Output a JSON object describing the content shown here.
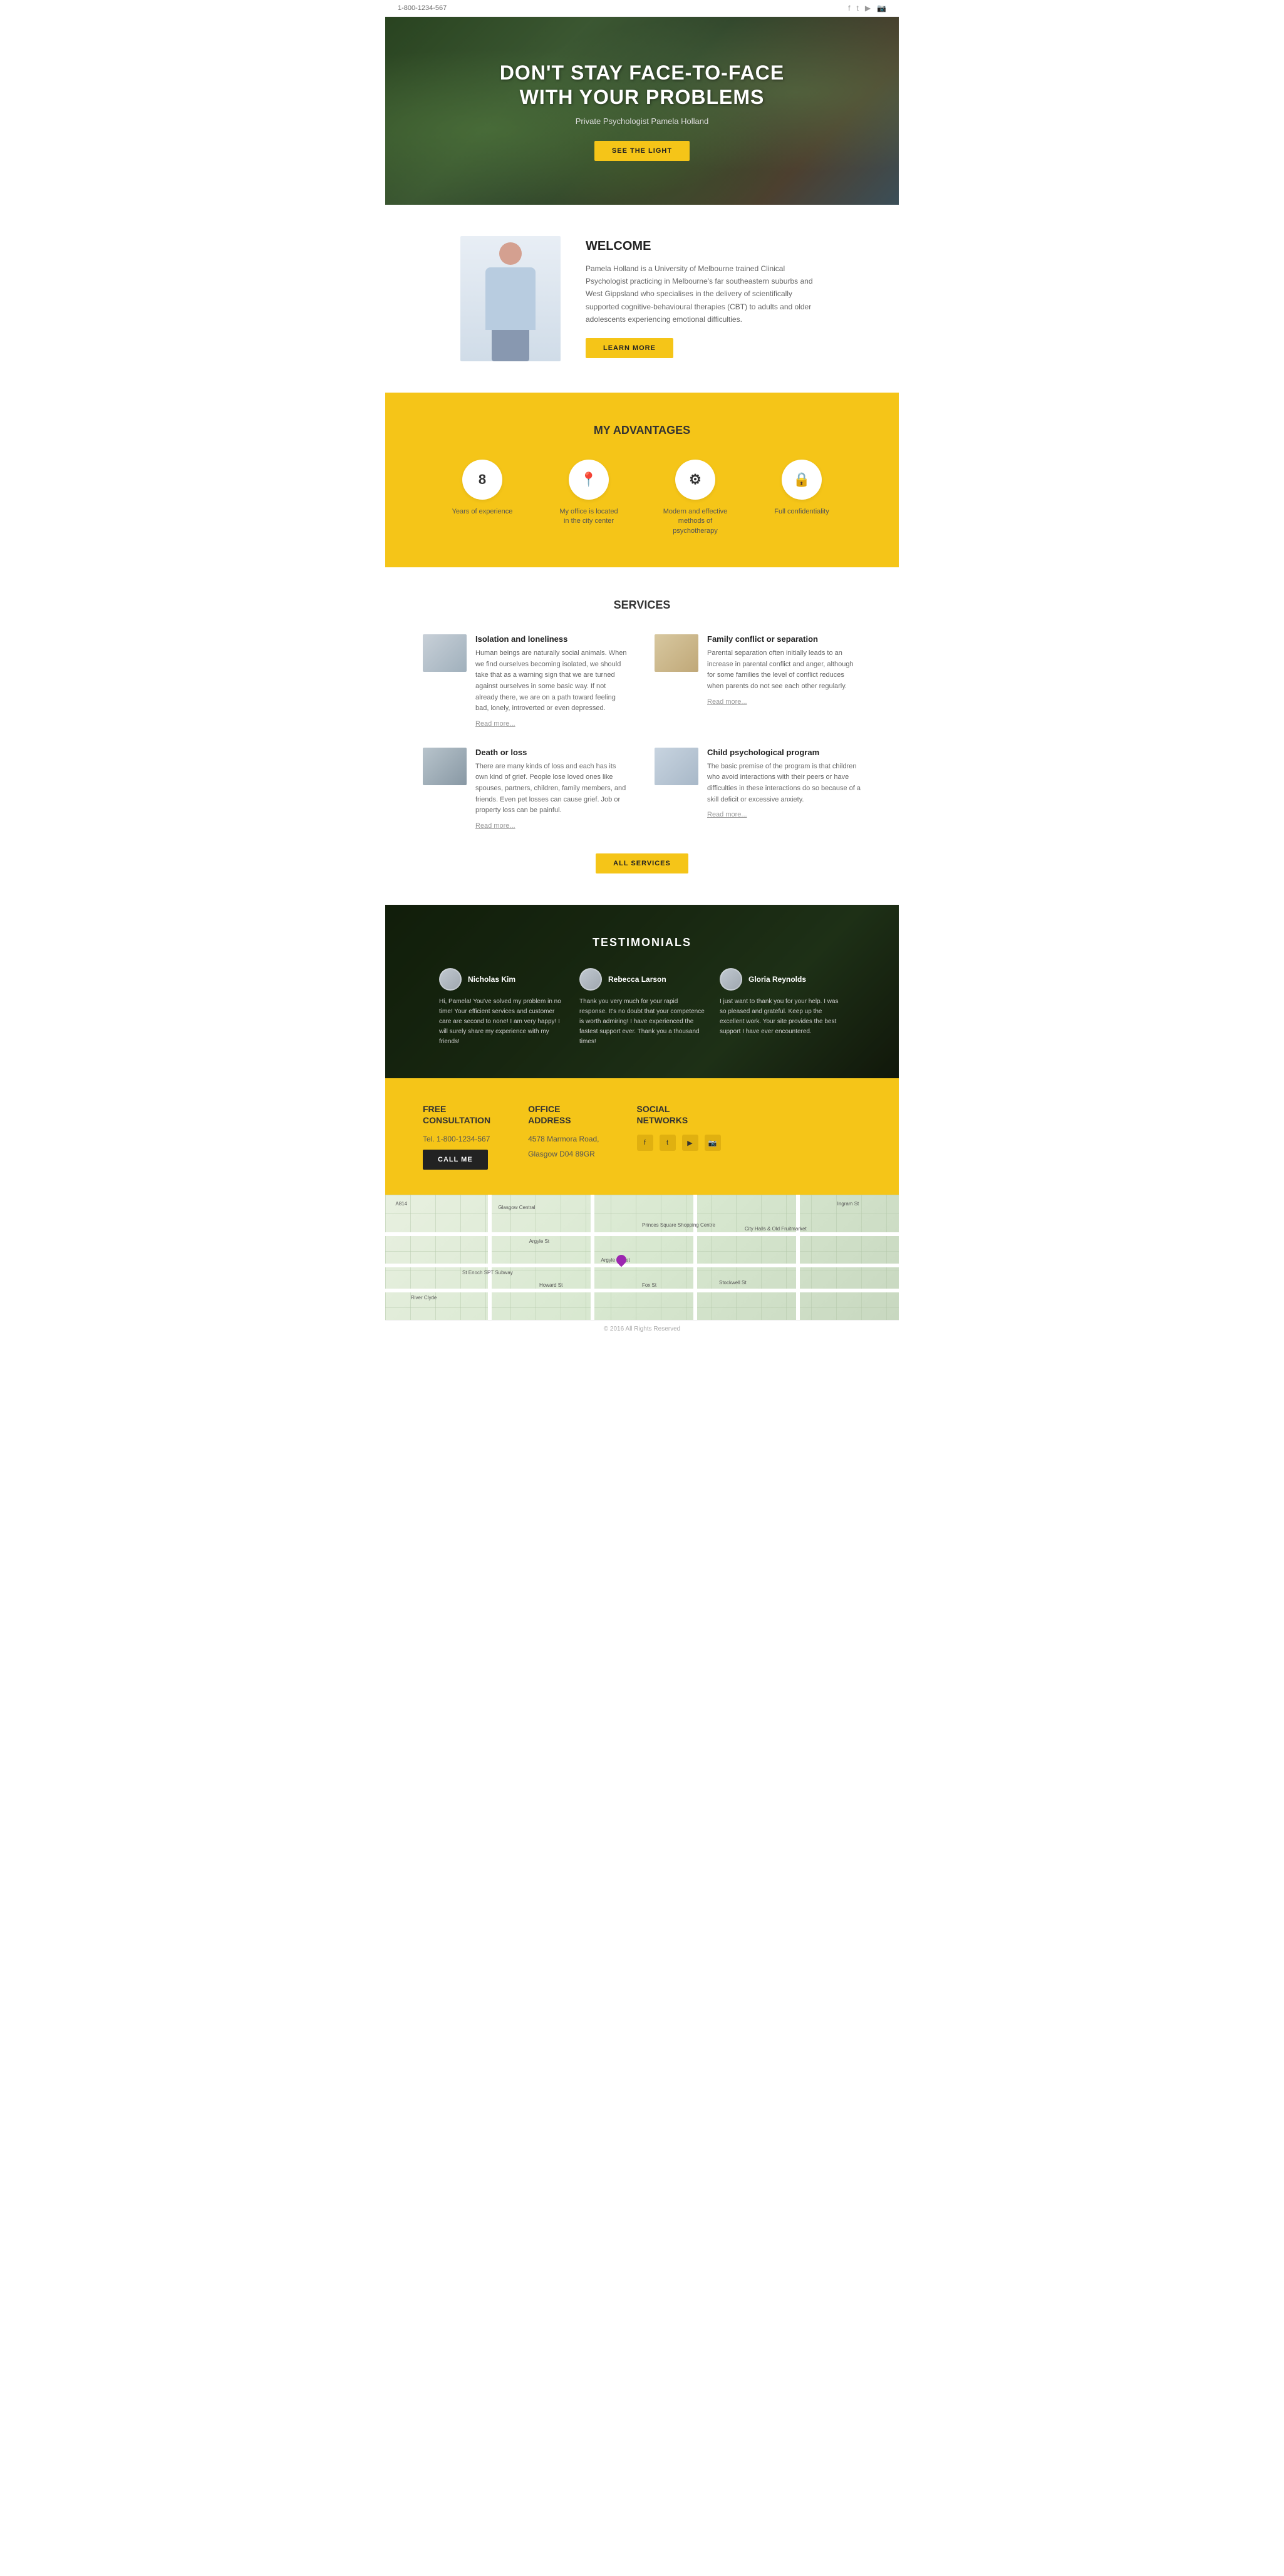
{
  "topbar": {
    "phone": "1-800-1234-567",
    "social_icons": [
      "f",
      "t",
      "▶",
      "📷"
    ]
  },
  "hero": {
    "headline_line1": "DON'T STAY FACE-TO-FACE",
    "headline_line2": "WITH YOUR PROBLEMS",
    "subtitle": "Private Psychologist Pamela Holland",
    "cta_button": "SEE THE LIGHT"
  },
  "welcome": {
    "title": "WELCOME",
    "body": "Pamela Holland is a University of Melbourne trained Clinical Psychologist practicing in Melbourne's far southeastern suburbs and West Gippsland who specialises in the delivery of scientifically supported cognitive-behavioural therapies (CBT) to adults and older adolescents experiencing emotional difficulties.",
    "button": "LEARN MORE"
  },
  "advantages": {
    "title": "MY ADVANTAGES",
    "items": [
      {
        "icon": "8",
        "label": "Years of experience",
        "type": "number"
      },
      {
        "icon": "📍",
        "label": "My office is located\nin the city center",
        "type": "location"
      },
      {
        "icon": "⚙",
        "label": "Modern and effective\nmethods of psychotherapy",
        "type": "settings"
      },
      {
        "icon": "🔒",
        "label": "Full confidentiality",
        "type": "lock"
      }
    ]
  },
  "services": {
    "title": "SERVICES",
    "items": [
      {
        "id": "isolation",
        "title": "Isolation and loneliness",
        "body": "Human beings are naturally social animals. When we find ourselves becoming isolated, we should take that as a warning sign that we are turned against ourselves in some basic way. If not already there, we are on a path toward feeling bad, lonely, introverted or even depressed.",
        "read_more": "Read more..."
      },
      {
        "id": "family",
        "title": "Family conflict or separation",
        "body": "Parental separation often initially leads to an increase in parental conflict and anger, although for some families the level of conflict reduces when parents do not see each other regularly.",
        "read_more": "Read more..."
      },
      {
        "id": "death",
        "title": "Death or loss",
        "body": "There are many kinds of loss and each has its own kind of grief. People lose loved ones like spouses, partners, children, family members, and friends. Even pet losses can cause grief. Job or property loss can be painful.",
        "read_more": "Read more..."
      },
      {
        "id": "child",
        "title": "Child psychological program",
        "body": "The basic premise of the program is that children who avoid interactions with their peers or have difficulties in these interactions do so because of a skill deficit or excessive anxiety.",
        "read_more": "Read more..."
      }
    ],
    "all_services_button": "ALL SERVICES"
  },
  "testimonials": {
    "title": "TESTIMONIALS",
    "items": [
      {
        "name": "Nicholas Kim",
        "text": "Hi, Pamela! You've solved my problem in no time! Your efficient services and customer care are second to none! I am very happy! I will surely share my experience with my friends!"
      },
      {
        "name": "Rebecca Larson",
        "text": "Thank you very much for your rapid response. It's no doubt that your competence is worth admiring! I have experienced the fastest support ever. Thank you a thousand times!"
      },
      {
        "name": "Gloria Reynolds",
        "text": "I just want to thank you for your help. I was so pleased and grateful. Keep up the excellent work. Your site provides the best support I have ever encountered."
      }
    ]
  },
  "footer": {
    "consultation": {
      "title": "FREE\nCONSULTATION",
      "phone": "Tel. 1-800-1234-567",
      "button": "CALL ME"
    },
    "address": {
      "title": "OFFICE\nADDRESS",
      "line1": "4578 Marmora Road,",
      "line2": "Glasgow D04 89GR"
    },
    "social": {
      "title": "SOCIAL\nNETWORKS",
      "icons": [
        "f",
        "t",
        "▶",
        "📷"
      ]
    }
  },
  "copyright": "© 2016 All Rights Reserved"
}
